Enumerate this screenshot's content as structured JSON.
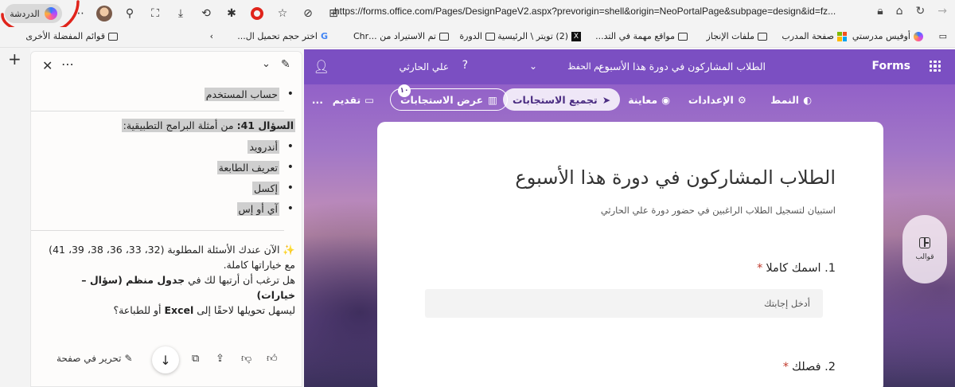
{
  "browser": {
    "chat_label": "الدردشة",
    "url": "https://forms.office.com/Pages/DesignPageV2.aspx?prevorigin=shell&origin=NeoPortalPage&subpage=design&id=fz..."
  },
  "favorites": {
    "items": [
      {
        "label": "أوفيس مدرستي",
        "icon": "copilot"
      },
      {
        "label": "صفحة المدرب",
        "icon": "ms"
      },
      {
        "label": "ملفات الإنجاز",
        "icon": "folder"
      },
      {
        "label": "مواقع مهمة في التد...",
        "icon": "folder"
      },
      {
        "label": "(2) تويتر \\ الرئيسية",
        "icon": "x"
      },
      {
        "label": "الدورة",
        "icon": "folder"
      },
      {
        "label": "تم الاستيراد من ...Chr",
        "icon": "folder"
      },
      {
        "label": "اختر حجم تحميل ال...",
        "icon": "g"
      },
      {
        "label": "قوائم المفضلة الأخرى",
        "icon": "folder"
      }
    ]
  },
  "copilot": {
    "top_item": "حساب المستخدم",
    "question_prefix": "السؤال 41:",
    "question_text": " من أمثلة البرامج التطبيقية:",
    "options": [
      "أندرويد",
      "تعريف الطابعة",
      "إكسل",
      "آي أو إس"
    ],
    "answer_line1": "✨ الآن عندك الأسئلة المطلوبة (32، 33، 36، 38، 39، 41) مع خياراتها كاملة.",
    "answer_line2_pre": "هل ترغب أن أرتبها لك في ",
    "answer_line2_bold": "جدول منظم (سؤال – خيارات)",
    "answer_line3_pre": " ليسهل تحويلها لاحقًا إلى ",
    "answer_line3_bold": "Excel",
    "answer_line3_post": " أو للطباعة؟",
    "edit_label": "تحرير في صفحة"
  },
  "forms": {
    "brand": "Forms",
    "header_title": "الطلاب المشاركون في دورة هذا الأسبوع",
    "saved_status": "تم الحفظ",
    "user_name": "علي الحارثي",
    "commands": {
      "style": "النمط",
      "settings": "الإعدادات",
      "preview": "معاينة",
      "collect": "تجميع الاستجابات",
      "view_responses": "عرض الاستجابات",
      "responses_count": "١٠",
      "present": "تقديم",
      "more": "..."
    },
    "card": {
      "title": "الطلاب المشاركون في دورة هذا الأسبوع",
      "description": "استبيان لتسجيل الطلاب الراغبين في حضور دورة علي الحارثي",
      "q1_number": "1.",
      "q1_text": "اسمك كاملا",
      "answer_placeholder": "أدخل إجابتك",
      "q2_number": "2.",
      "q2_text": "فصلك",
      "required_mark": "*"
    },
    "templates_label": "قوالب"
  },
  "colors": {
    "forms_purple": "#7b4fc2",
    "required_red": "#c0392b",
    "annotation_red": "#e0241b"
  }
}
